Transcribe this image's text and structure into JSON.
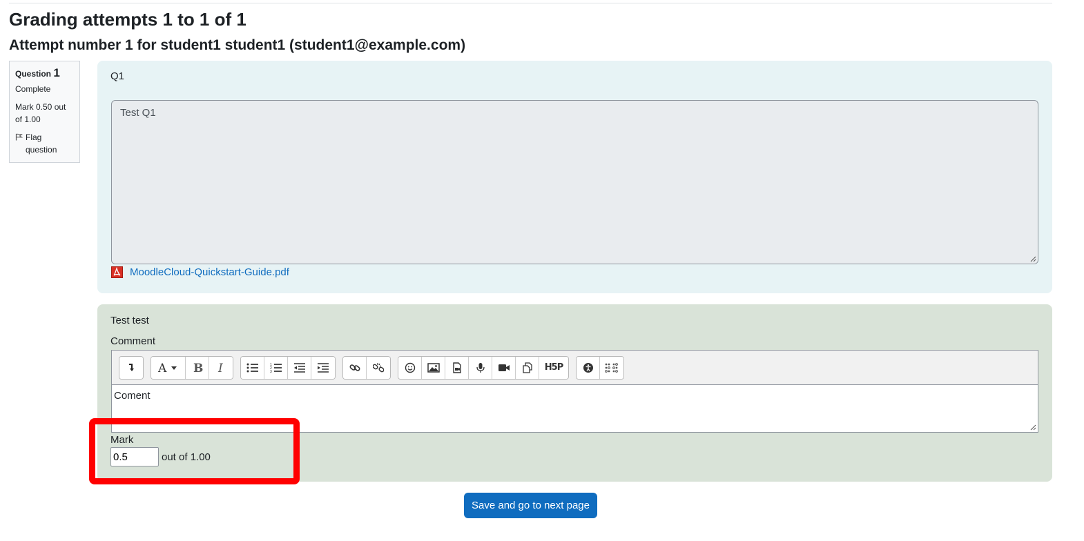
{
  "page_title": "Grading attempts 1 to 1 of 1",
  "attempt_title": "Attempt number 1 for student1 student1 (student1@example.com)",
  "question_info": {
    "question_label": "Question",
    "question_number": "1",
    "state": "Complete",
    "grade": "Mark 0.50 out of 1.00",
    "flag_label": "Flag question"
  },
  "question": {
    "text": "Q1",
    "answer": "Test Q1",
    "attachment_name": "MoodleCloud-Quickstart-Guide.pdf"
  },
  "grading": {
    "feedback_text": "Test test",
    "comment_label": "Comment",
    "comment_value": "Coment",
    "mark_label": "Mark",
    "mark_value": "0.5",
    "out_of": "out of 1.00"
  },
  "toolbar_icons": [
    "collapse-icon",
    "font-style-icon",
    "bold-icon",
    "italic-icon",
    "unordered-list-icon",
    "ordered-list-icon",
    "outdent-icon",
    "indent-icon",
    "link-icon",
    "unlink-icon",
    "emoji-icon",
    "image-icon",
    "media-icon",
    "record-audio-icon",
    "record-video-icon",
    "manage-files-icon",
    "h5p-icon",
    "accessibility-checker-icon",
    "screenreader-helper-icon"
  ],
  "h5p_label": "H5P",
  "save_button": "Save and go to next page",
  "colors": {
    "primary": "#0f6cbf",
    "formulation_bg": "#e7f3f5",
    "comment_bg": "#d9e3d8",
    "highlight": "#ff0000"
  }
}
